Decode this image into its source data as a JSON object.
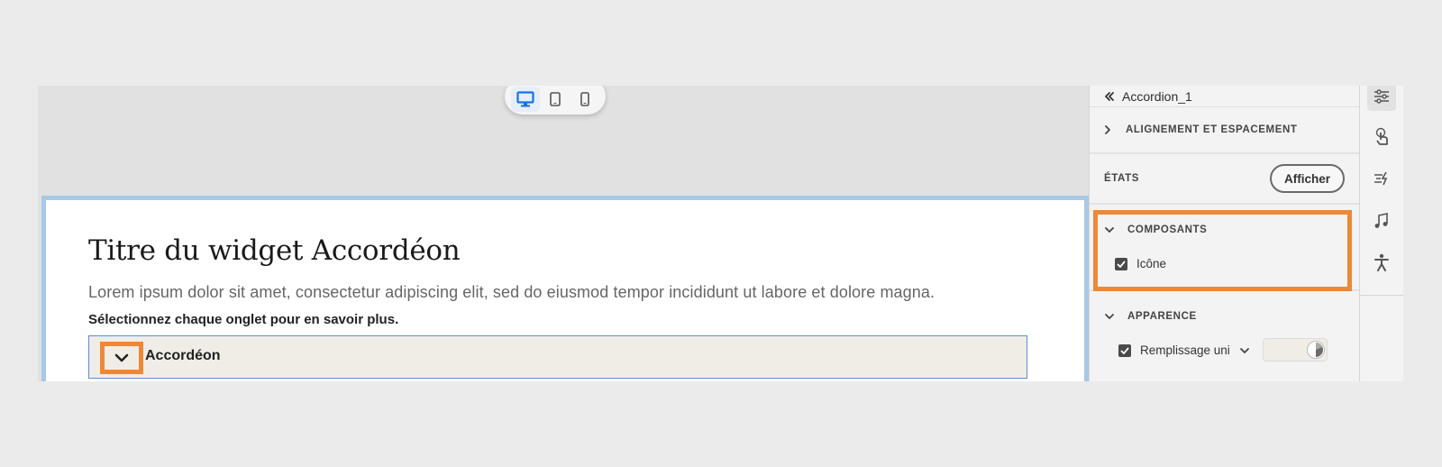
{
  "panel": {
    "component_name": "Accordion_1",
    "sections": {
      "alignment": "ALIGNEMENT ET ESPACEMENT",
      "states": "ÉTATS",
      "states_button": "Afficher",
      "components": "COMPOSANTS",
      "components_checkbox": "Icône",
      "appearance": "APPARENCE",
      "fill_label": "Remplissage uni"
    }
  },
  "widget": {
    "title": "Titre du widget Accordéon",
    "description": "Lorem ipsum dolor sit amet, consectetur adipiscing elit, sed do eiusmod tempor incididunt ut labore et dolore magna.",
    "instruction": "Sélectionnez chaque onglet pour en savoir plus.",
    "accordion_label": "Accordéon"
  },
  "device_bar": {
    "icons": [
      "desktop-icon",
      "tablet-icon",
      "mobile-icon"
    ],
    "active": "desktop"
  },
  "rail": {
    "icons": [
      "sliders-icon",
      "touch-icon",
      "animation-icon",
      "music-icon",
      "accessibility-icon"
    ]
  },
  "colors": {
    "highlight": "#ef8836",
    "selection_border": "#a8c8e6",
    "accent_blue": "#1473e6",
    "accordion_bg": "#f0ede6"
  }
}
